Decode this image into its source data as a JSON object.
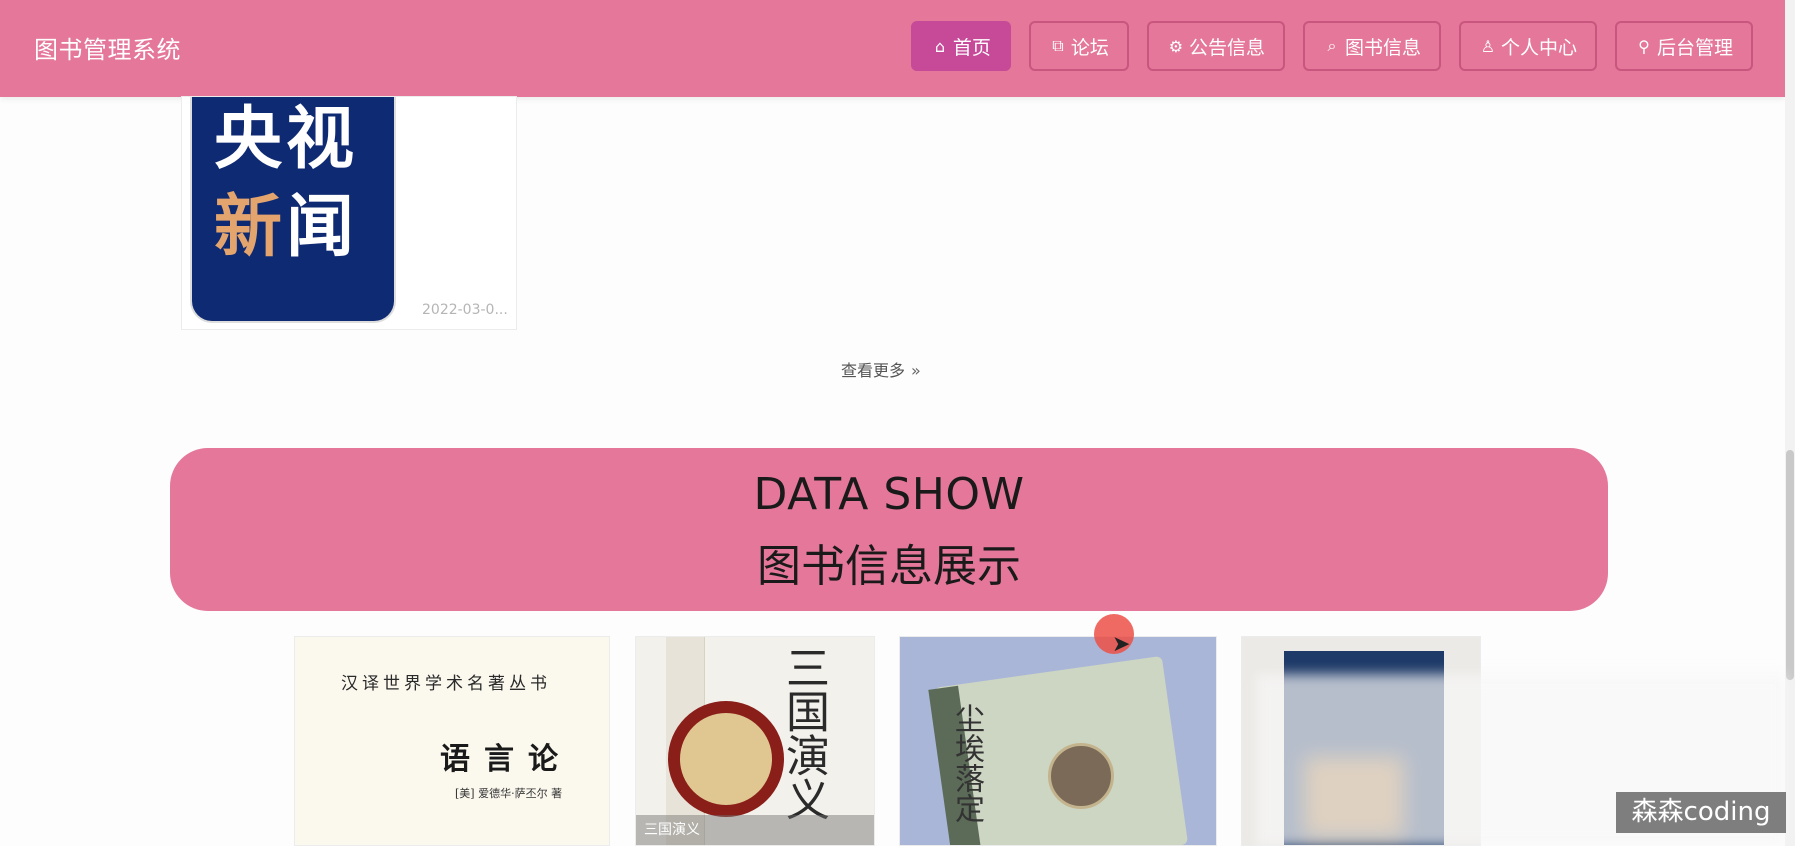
{
  "app": {
    "title": "图书管理系统"
  },
  "nav": {
    "items": [
      {
        "icon": "home-icon",
        "glyph": "⌂",
        "label": "首页",
        "active": true
      },
      {
        "icon": "forum-icon",
        "glyph": "⧉",
        "label": "论坛",
        "active": false
      },
      {
        "icon": "notice-icon",
        "glyph": "⚙",
        "label": "公告信息",
        "active": false
      },
      {
        "icon": "book-icon",
        "glyph": "⌕",
        "label": "图书信息",
        "active": false
      },
      {
        "icon": "user-icon",
        "glyph": "♙",
        "label": "个人中心",
        "active": false
      },
      {
        "icon": "link-icon",
        "glyph": "⚲",
        "label": "后台管理",
        "active": false
      }
    ]
  },
  "news": {
    "logo_line1": "央视",
    "logo_line2_a": "新",
    "logo_line2_b": "闻",
    "date": "2022-03-0..."
  },
  "more": {
    "label": "查看更多",
    "icon": "double-chevron-right-icon",
    "glyph": "»"
  },
  "section": {
    "title_en": "DATA SHOW",
    "title_zh": "图书信息展示"
  },
  "books": [
    {
      "cover_series": "汉译世界学术名著丛书",
      "cover_title": "语言论",
      "cover_author": "[美] 爱德华·萨丕尔 著"
    },
    {
      "cover_title": "三国演义",
      "caption": "三国演义"
    },
    {
      "cover_title": "尘埃落定"
    },
    {}
  ],
  "watermark": "森森coding",
  "colors": {
    "brand_pink": "#e4779a",
    "active_nav": "#c64a98"
  }
}
